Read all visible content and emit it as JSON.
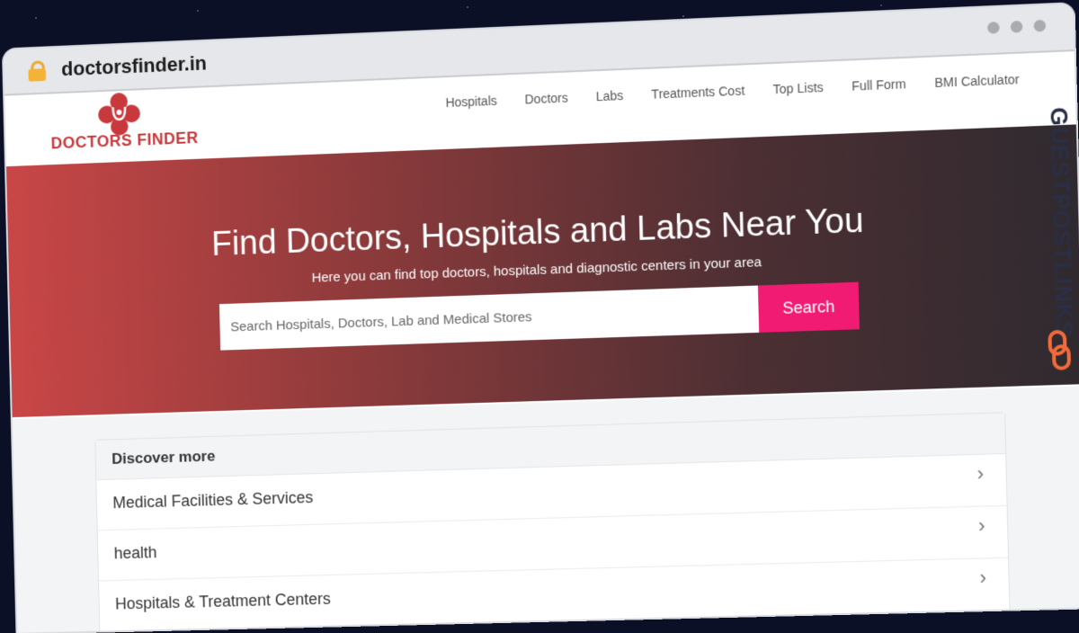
{
  "browser": {
    "url": "doctorsfinder.in"
  },
  "header": {
    "logo_text": "DOCTORS FINDER",
    "nav": [
      "Hospitals",
      "Doctors",
      "Labs",
      "Treatments Cost",
      "Top Lists",
      "Full Form",
      "BMI Calculator"
    ]
  },
  "hero": {
    "title": "Find Doctors, Hospitals and Labs Near You",
    "subtitle": "Here you can find top doctors, hospitals and diagnostic centers in your area",
    "search_placeholder": "Search Hospitals, Doctors, Lab and Medical Stores",
    "search_button": "Search"
  },
  "discover": {
    "title": "Discover more",
    "items": [
      "Medical Facilities & Services",
      "health",
      "Hospitals & Treatment Centers"
    ]
  },
  "watermark": {
    "text": "GUESTPOSTLINKS"
  },
  "colors": {
    "brand": "#c8393d",
    "search_button": "#f21b73"
  }
}
